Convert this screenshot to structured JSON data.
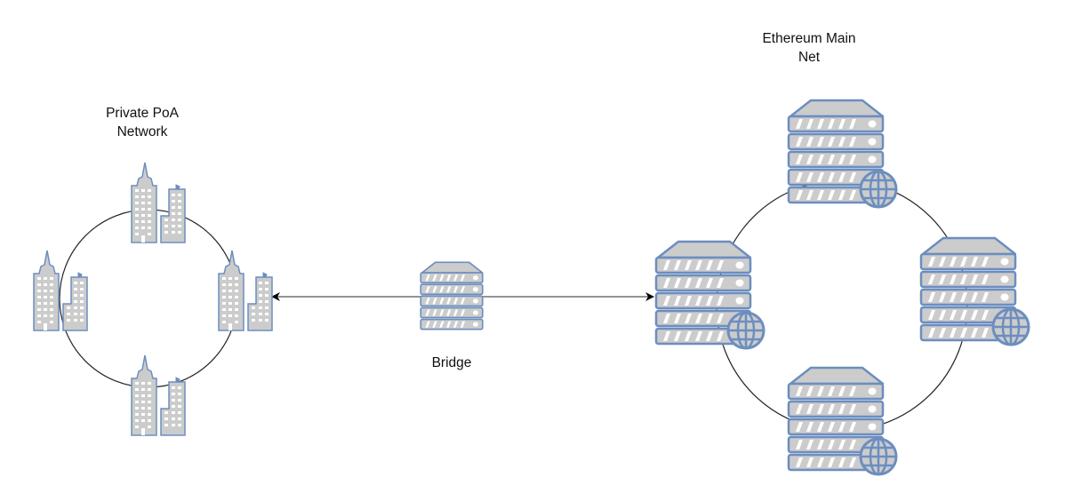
{
  "diagram": {
    "private_network": {
      "title_line1": "Private PoA",
      "title_line2": "Network",
      "node_type": "building-icon",
      "nodes": [
        "top",
        "left",
        "right",
        "bottom"
      ]
    },
    "bridge": {
      "label": "Bridge",
      "node_type": "server-icon"
    },
    "main_network": {
      "title_line1": "Ethereum Main",
      "title_line2": "Net",
      "node_type": "web-server-icon",
      "nodes": [
        "top",
        "left",
        "right",
        "bottom"
      ]
    },
    "connections": [
      {
        "from": "bridge",
        "to": "private_network",
        "arrow": "end"
      },
      {
        "from": "bridge",
        "to": "main_network",
        "arrow": "end"
      }
    ],
    "colors": {
      "icon_stroke": "#6c8ebf",
      "icon_fill": "#cccccc",
      "line": "#000000",
      "connector": "#555555"
    }
  }
}
